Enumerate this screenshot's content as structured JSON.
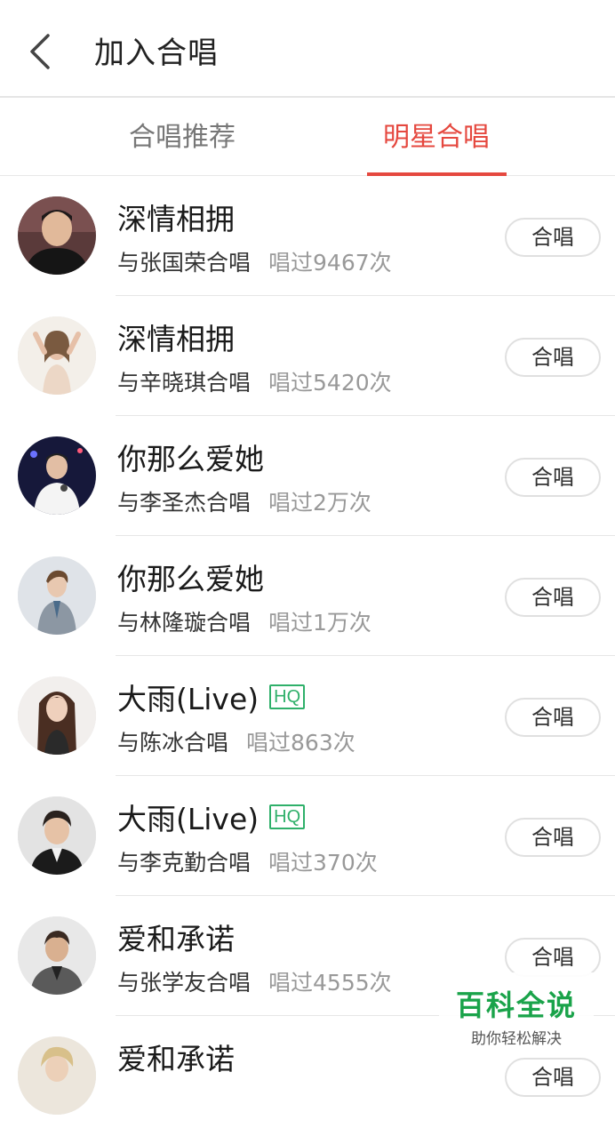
{
  "header": {
    "title": "加入合唱",
    "back_icon": "chevron-left-icon"
  },
  "tabs": [
    {
      "label": "合唱推荐",
      "active": false
    },
    {
      "label": "明星合唱",
      "active": true
    }
  ],
  "colors": {
    "accent": "#e5483f",
    "hq": "#2fb06a",
    "watermark": "#1aa34a"
  },
  "list": [
    {
      "song": "深情相拥",
      "hq": "",
      "artist": "与张国荣合唱",
      "count": "唱过9467次",
      "button": "合唱"
    },
    {
      "song": "深情相拥",
      "hq": "",
      "artist": "与辛晓琪合唱",
      "count": "唱过5420次",
      "button": "合唱"
    },
    {
      "song": "你那么爱她",
      "hq": "",
      "artist": "与李圣杰合唱",
      "count": "唱过2万次",
      "button": "合唱"
    },
    {
      "song": "你那么爱她",
      "hq": "",
      "artist": "与林隆璇合唱",
      "count": "唱过1万次",
      "button": "合唱"
    },
    {
      "song": "大雨(Live)",
      "hq": "HQ",
      "artist": "与陈冰合唱",
      "count": "唱过863次",
      "button": "合唱"
    },
    {
      "song": "大雨(Live)",
      "hq": "HQ",
      "artist": "与李克勤合唱",
      "count": "唱过370次",
      "button": "合唱"
    },
    {
      "song": "爱和承诺",
      "hq": "",
      "artist": "与张学友合唱",
      "count": "唱过4555次",
      "button": "合唱"
    },
    {
      "song": "爱和承诺",
      "hq": "",
      "artist": "",
      "count": "",
      "button": "合唱"
    }
  ],
  "watermark": {
    "main": "百科全说",
    "sub": "助你轻松解决"
  }
}
